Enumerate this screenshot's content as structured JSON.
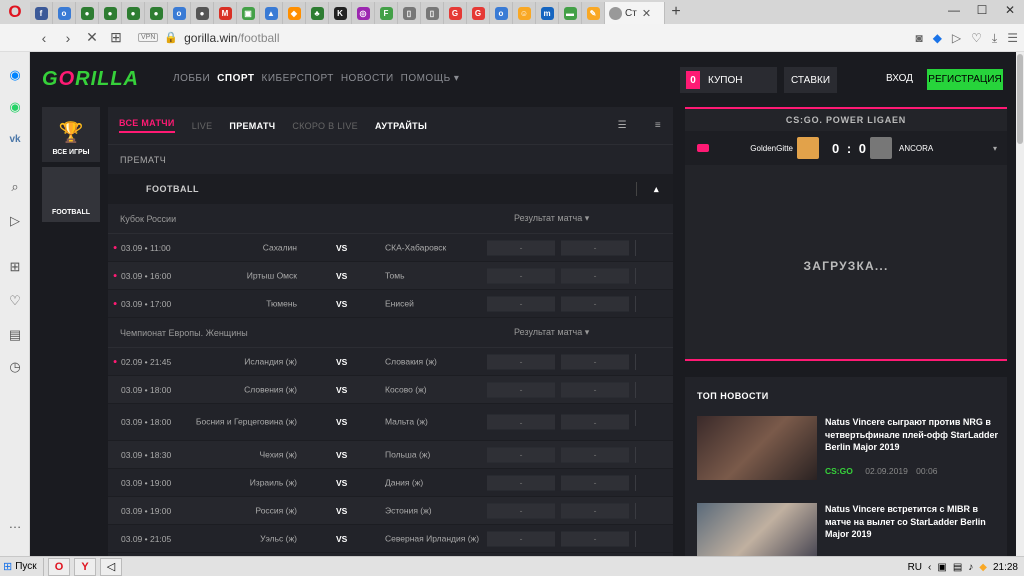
{
  "browser": {
    "active_tab_title": "Ст",
    "url_host": "gorilla.win",
    "url_path": "/football",
    "vpn_label": "VPN",
    "tab_favicons": [
      {
        "letter": "f",
        "color": "#3b5998"
      },
      {
        "letter": "o",
        "color": "#3a7bd5"
      },
      {
        "letter": "●",
        "color": "#2e7d32"
      },
      {
        "letter": "●",
        "color": "#2e7d32"
      },
      {
        "letter": "●",
        "color": "#2e7d32"
      },
      {
        "letter": "●",
        "color": "#2e7d32"
      },
      {
        "letter": "o",
        "color": "#3a7bd5"
      },
      {
        "letter": "●",
        "color": "#555555"
      },
      {
        "letter": "M",
        "color": "#d93025"
      },
      {
        "letter": "▣",
        "color": "#43a047"
      },
      {
        "letter": "▲",
        "color": "#3a7bd5"
      },
      {
        "letter": "◆",
        "color": "#ff8f00"
      },
      {
        "letter": "♣",
        "color": "#2e7d32"
      },
      {
        "letter": "K",
        "color": "#222222"
      },
      {
        "letter": "◎",
        "color": "#9c27b0"
      },
      {
        "letter": "F",
        "color": "#43a047"
      },
      {
        "letter": "▯",
        "color": "#777777"
      },
      {
        "letter": "▯",
        "color": "#777777"
      },
      {
        "letter": "G",
        "color": "#e53935"
      },
      {
        "letter": "G",
        "color": "#e53935"
      },
      {
        "letter": "o",
        "color": "#3a7bd5"
      },
      {
        "letter": "☺",
        "color": "#f9a825"
      },
      {
        "letter": "m",
        "color": "#1565c0"
      },
      {
        "letter": "▬",
        "color": "#43a047"
      },
      {
        "letter": "✎",
        "color": "#f9a825"
      }
    ]
  },
  "site": {
    "logo_main": "G",
    "logo_accent": "O",
    "logo_rest": "RILLA",
    "nav": [
      "ЛОББИ",
      "СПОРТ",
      "КИБЕРСПОРТ",
      "НОВОСТИ",
      "ПОМОЩЬ ▾"
    ],
    "coupon_count": "0",
    "coupon_label": "КУПОН",
    "bets_label": "СТАВКИ",
    "login_label": "ВХОД",
    "register_label": "РЕГИСТРАЦИЯ",
    "categories": [
      {
        "label": "ВСЕ ИГРЫ"
      },
      {
        "label": "FOOTBALL"
      }
    ]
  },
  "matches": {
    "tabs": [
      "ВСЕ МАТЧИ",
      "LIVE",
      "ПРЕМАТЧ",
      "СКОРО В LIVE",
      "АУТРАЙТЫ"
    ],
    "section": "ПРЕМАТЧ",
    "sport": "FOOTBALL",
    "leagues": [
      {
        "name": "Кубок России",
        "market": "Результат матча ▾",
        "rows": [
          {
            "live": true,
            "time": "03.09 • 11:00",
            "home": "Сахалин",
            "away": "СКА-Хабаровск"
          },
          {
            "live": true,
            "time": "03.09 • 16:00",
            "home": "Иртыш Омск",
            "away": "Томь"
          },
          {
            "live": true,
            "time": "03.09 • 17:00",
            "home": "Тюмень",
            "away": "Енисей"
          }
        ]
      },
      {
        "name": "Чемпионат Европы. Женщины",
        "market": "Результат матча ▾",
        "rows": [
          {
            "live": true,
            "time": "02.09 • 21:45",
            "home": "Исландия (ж)",
            "away": "Словакия (ж)"
          },
          {
            "live": false,
            "time": "03.09 • 18:00",
            "home": "Словения (ж)",
            "away": "Косово (ж)"
          },
          {
            "live": false,
            "time": "03.09 • 18:00",
            "home": "Босния и Герцеговина (ж)",
            "away": "Мальта (ж)",
            "tall": true
          },
          {
            "live": false,
            "time": "03.09 • 18:30",
            "home": "Чехия (ж)",
            "away": "Польша (ж)"
          },
          {
            "live": false,
            "time": "03.09 • 19:00",
            "home": "Израиль (ж)",
            "away": "Дания (ж)"
          },
          {
            "live": false,
            "time": "03.09 • 19:00",
            "home": "Россия (ж)",
            "away": "Эстония (ж)"
          },
          {
            "live": false,
            "time": "03.09 • 21:05",
            "home": "Уэльс (ж)",
            "away": "Северная Ирландия (ж)"
          }
        ]
      }
    ],
    "vs": "VS",
    "odd_placeholder": "-"
  },
  "stream": {
    "title": "CS:GO. POWER LIGAEN",
    "team1": "GoldenGitte",
    "score": "0 : 0",
    "team2": "ANCORA",
    "loading": "ЗАГРУЗКА..."
  },
  "news": {
    "title": "ТОП НОВОСТИ",
    "items": [
      {
        "headline": "Natus Vincere сыграют против NRG в четвертьфинале плей-офф StarLadder Berlin Major 2019",
        "tag": "CS:GO",
        "date": "02.09.2019",
        "time": "00:06"
      },
      {
        "headline": "Natus Vincere встретится с MIBR в матче на вылет со StarLadder Berlin Major 2019",
        "tag": "",
        "date": "",
        "time": ""
      }
    ]
  },
  "taskbar": {
    "start_label": "Пуск",
    "lang": "RU",
    "clock": "21:28"
  }
}
